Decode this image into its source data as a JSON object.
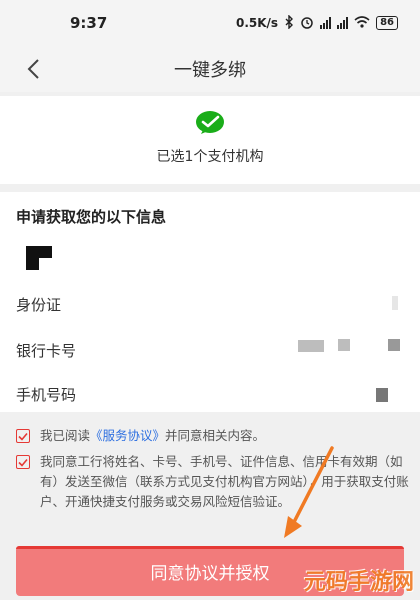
{
  "status_bar": {
    "time": "9:37",
    "network_speed": "0.5K/s",
    "battery": "86"
  },
  "nav": {
    "title": "一键多绑"
  },
  "org": {
    "selected_text": "已选1个支付机构",
    "logo_icon": "wechat-pay-icon",
    "brand_color": "#1aad19"
  },
  "info": {
    "title": "申请获取您的以下信息",
    "rows": [
      {
        "label": "身份证"
      },
      {
        "label": "银行卡号"
      },
      {
        "label": "手机号码"
      }
    ]
  },
  "agreements": {
    "item1_prefix": "我已阅读",
    "item1_link": "《服务协议》",
    "item1_suffix": "并同意相关内容。",
    "item2_text": "我同意工行将姓名、卡号、手机号、证件信息、信用卡有效期（如有）发送至微信（联系方式见支付机构官方网站），用于获取支付账户、开通快捷支付服务或交易风险短信验证。"
  },
  "submit": {
    "label": "同意协议并授权",
    "color": "#f27b7b"
  },
  "watermark": "元码手游网"
}
